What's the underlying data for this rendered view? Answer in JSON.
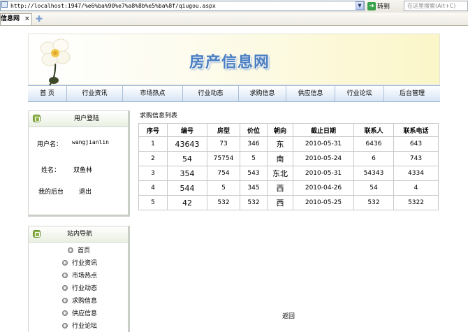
{
  "browser": {
    "url": "http://localhost:1947/%e6%ba%90%e7%a8%8b%e5%ba%8f/qiugou.aspx",
    "go_label": "转到",
    "search_placeholder": "在这里搜索(Alt+C)",
    "tab_title": "信息网",
    "tab_close": "×",
    "new_tab": "✚"
  },
  "site": {
    "title": "房产信息网",
    "nav": [
      "首 页",
      "行业资讯",
      "市场热点",
      "行业动态",
      "求购信息",
      "供应信息",
      "行业论坛",
      "后台管理"
    ]
  },
  "login_panel": {
    "title": "用户登陆",
    "username_label": "用户名：",
    "username_value": "wangjianlin",
    "name_label": "姓名：",
    "name_value": "双鱼林",
    "backend_label": "我的后台",
    "logout_label": "退出"
  },
  "nav_panel": {
    "title": "站内导航",
    "items": [
      "首页",
      "行业资讯",
      "市场热点",
      "行业动态",
      "求购信息",
      "供应信息",
      "行业论坛"
    ]
  },
  "listing": {
    "title": "求购信息列表",
    "headers": [
      "序号",
      "编号",
      "房型",
      "价位",
      "朝向",
      "截止日期",
      "联系人",
      "联系电话"
    ],
    "rows": [
      [
        "1",
        "43643",
        "73",
        "346",
        "东",
        "2010-05-31",
        "6436",
        "643"
      ],
      [
        "2",
        "54",
        "75754",
        "5",
        "南",
        "2010-05-24",
        "6",
        "743"
      ],
      [
        "3",
        "354",
        "754",
        "543",
        "东北",
        "2010-05-31",
        "54343",
        "4334"
      ],
      [
        "4",
        "544",
        "5",
        "345",
        "西",
        "2010-04-26",
        "54",
        "4"
      ],
      [
        "5",
        "42",
        "532",
        "532",
        "西",
        "2010-05-25",
        "532",
        "5322"
      ]
    ],
    "back_label": "返回"
  },
  "colors": {
    "title_blue": "#4a7fc1",
    "nav_border": "#9bb5d4",
    "panel_icon_green": "#8fb44a"
  }
}
